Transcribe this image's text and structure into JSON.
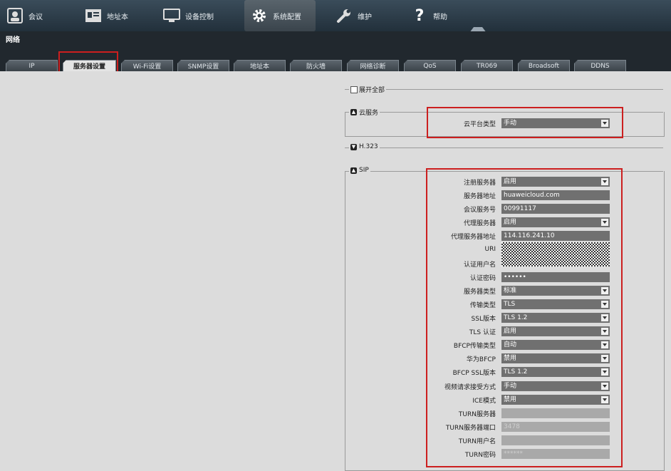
{
  "topnav": {
    "items": [
      {
        "label": "会议",
        "icon": "meeting-icon"
      },
      {
        "label": "地址本",
        "icon": "addressbook-icon"
      },
      {
        "label": "设备控制",
        "icon": "monitor-icon"
      },
      {
        "label": "系统配置",
        "icon": "gear-icon",
        "active": true
      },
      {
        "label": "维护",
        "icon": "wrench-icon"
      },
      {
        "label": "帮助",
        "icon": "question-icon"
      }
    ]
  },
  "subbar": {
    "title": "网络"
  },
  "tabs": [
    "IP",
    "服务器设置",
    "Wi-Fi设置",
    "SNMP设置",
    "地址本",
    "防火墙",
    "网络诊断",
    "QoS",
    "TR069",
    "Broadsoft",
    "DDNS"
  ],
  "active_tab": "服务器设置",
  "sections": {
    "expand_all": "展开全部",
    "cloud": "云服务",
    "h323": "H.323",
    "sip": "SIP"
  },
  "cloud": {
    "label": "云平台类型",
    "value": "手动"
  },
  "sip_fields": [
    {
      "label": "注册服务器",
      "value": "启用",
      "type": "select"
    },
    {
      "label": "服务器地址",
      "value": "huaweicloud.com",
      "type": "text"
    },
    {
      "label": "会议服务号",
      "value": "00991117",
      "type": "text"
    },
    {
      "label": "代理服务器",
      "value": "启用",
      "type": "select"
    },
    {
      "label": "代理服务器地址",
      "value": "114.116.241.10",
      "type": "text"
    },
    {
      "label": "URI",
      "value": "",
      "type": "masked"
    },
    {
      "label": "认证用户名",
      "value": "",
      "type": "masked"
    },
    {
      "label": "认证密码",
      "value": "••••••",
      "type": "text"
    },
    {
      "label": "服务器类型",
      "value": "标准",
      "type": "select"
    },
    {
      "label": "传输类型",
      "value": "TLS",
      "type": "select"
    },
    {
      "label": "SSL版本",
      "value": "TLS 1.2",
      "type": "select"
    },
    {
      "label": "TLS 认证",
      "value": "启用",
      "type": "select"
    },
    {
      "label": "BFCP传输类型",
      "value": "自动",
      "type": "select"
    },
    {
      "label": "华为BFCP",
      "value": "禁用",
      "type": "select"
    },
    {
      "label": "BFCP SSL版本",
      "value": "TLS 1.2",
      "type": "select"
    },
    {
      "label": "视频请求接受方式",
      "value": "手动",
      "type": "select"
    },
    {
      "label": "ICE模式",
      "value": "禁用",
      "type": "select"
    },
    {
      "label": "TURN服务器",
      "value": "",
      "type": "disabled"
    },
    {
      "label": "TURN服务器端口",
      "value": "3478",
      "type": "disabled"
    },
    {
      "label": "TURN用户名",
      "value": "",
      "type": "disabled"
    },
    {
      "label": "TURN密码",
      "value": "******",
      "type": "disabled"
    }
  ],
  "colors": {
    "highlight": "#cc1f1f",
    "field_bg": "#707070",
    "nav_bg": "#2c3a45"
  }
}
